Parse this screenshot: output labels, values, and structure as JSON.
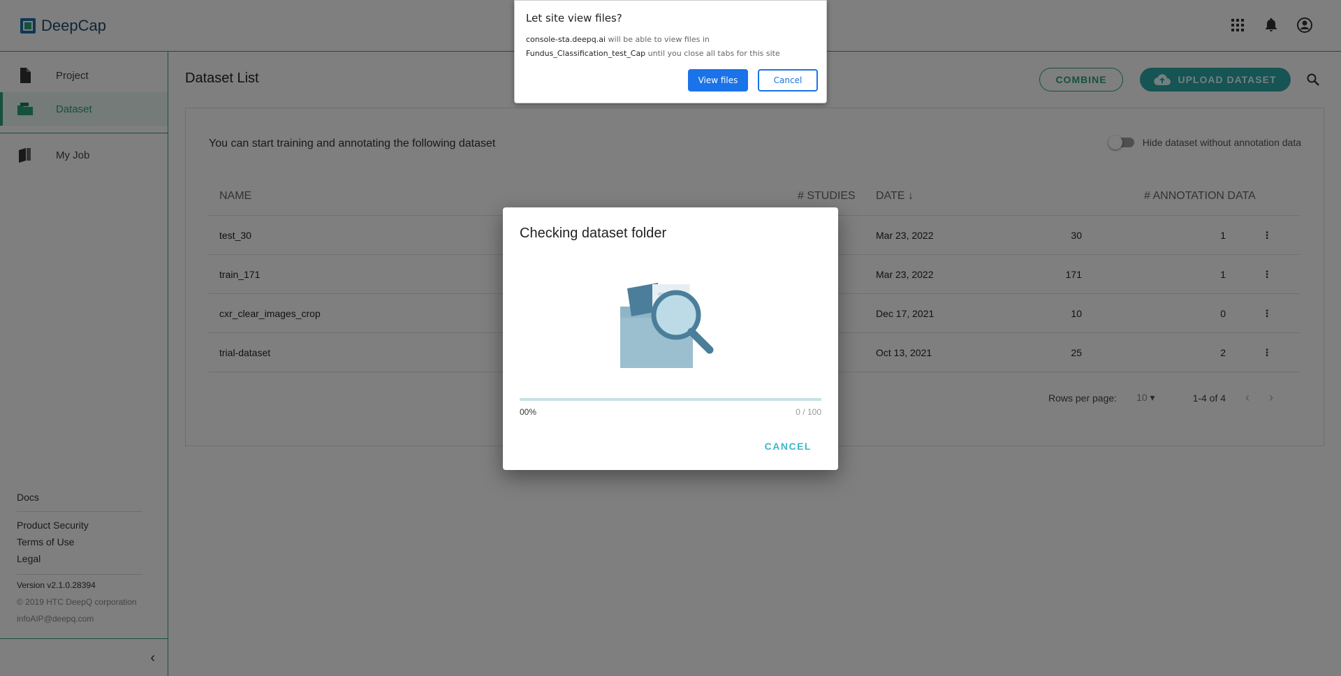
{
  "app": {
    "name": "DeepCap"
  },
  "sidebar": {
    "items": [
      {
        "label": "Project",
        "icon": "file-icon"
      },
      {
        "label": "Dataset",
        "icon": "folder-icon",
        "active": true
      },
      {
        "label": "My Job",
        "icon": "book-icon"
      }
    ],
    "footer": {
      "docs": "Docs",
      "product_security": "Product Security",
      "terms": "Terms of Use",
      "legal": "Legal",
      "version": "Version v2.1.0.28394",
      "copyright": "© 2019 HTC DeepQ corporation",
      "email": "infoAIP@deepq.com"
    }
  },
  "main": {
    "title": "Dataset List",
    "combine_label": "COMBINE",
    "upload_label": "UPLOAD DATASET",
    "intro": "You can start training and annotating the following dataset",
    "toggle_label": "Hide dataset without annotation data",
    "table": {
      "headers": {
        "name": "NAME",
        "studies": "# STUDIES",
        "date": "DATE",
        "annotation": "# ANNOTATION DATA"
      },
      "rows": [
        {
          "name": "test_30",
          "studies": "30",
          "date": "Mar 23, 2022",
          "annotation": "1"
        },
        {
          "name": "train_171",
          "studies": "171",
          "date": "Mar 23, 2022",
          "annotation": "1"
        },
        {
          "name": "cxr_clear_images_crop",
          "studies": "10",
          "date": "Dec 17, 2021",
          "annotation": "0"
        },
        {
          "name": "trial-dataset",
          "studies": "25",
          "date": "Oct 13, 2021",
          "annotation": "2"
        }
      ]
    },
    "pager": {
      "rows_per_page_label": "Rows per page:",
      "rows_per_page": "10",
      "range": "1-4 of 4"
    }
  },
  "modal": {
    "title": "Checking dataset folder",
    "progress_percent": "00%",
    "progress_count": "0 / 100",
    "progress_fraction": 0,
    "cancel_label": "CANCEL"
  },
  "permission": {
    "title": "Let site view files?",
    "site": "console-sta.deepq.ai",
    "text1": " will be able to view files in",
    "folder": "Fundus_Classification_test_Cap",
    "text2": " until you close all tabs for this site",
    "view_label": "View files",
    "cancel_label": "Cancel"
  },
  "colors": {
    "accent": "#2aa37a",
    "upload": "#2fa8a8",
    "link_blue": "#1a73e8",
    "modal_cancel": "#3fb6c9"
  }
}
